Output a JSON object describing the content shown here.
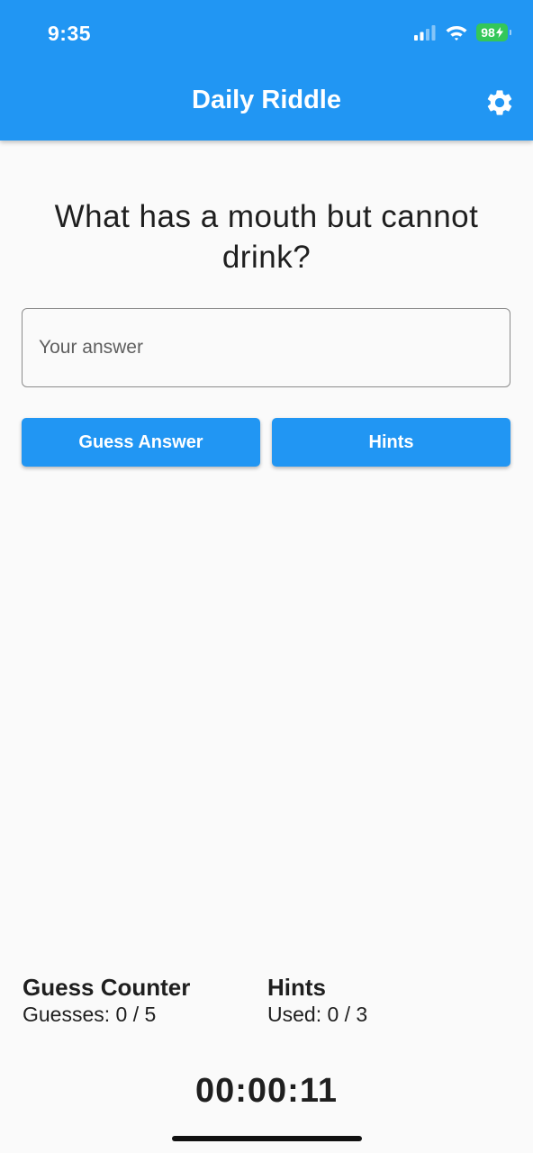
{
  "status_bar": {
    "time": "9:35",
    "battery": "98",
    "icons": [
      "signal-icon",
      "wifi-icon",
      "battery-icon"
    ]
  },
  "app_bar": {
    "title": "Daily Riddle",
    "settings_icon": "gear-icon",
    "color": "#2196f3"
  },
  "riddle": {
    "question": "What has a mouth but cannot drink?"
  },
  "answer": {
    "placeholder": "Your answer",
    "value": ""
  },
  "actions": {
    "guess_label": "Guess Answer",
    "hints_label": "Hints"
  },
  "stats": {
    "guess_title": "Guess Counter",
    "guess_value": "Guesses: 0 / 5",
    "hints_title": "Hints",
    "hints_value": "Used: 0 / 3"
  },
  "timer": {
    "value": "00:00:11"
  }
}
